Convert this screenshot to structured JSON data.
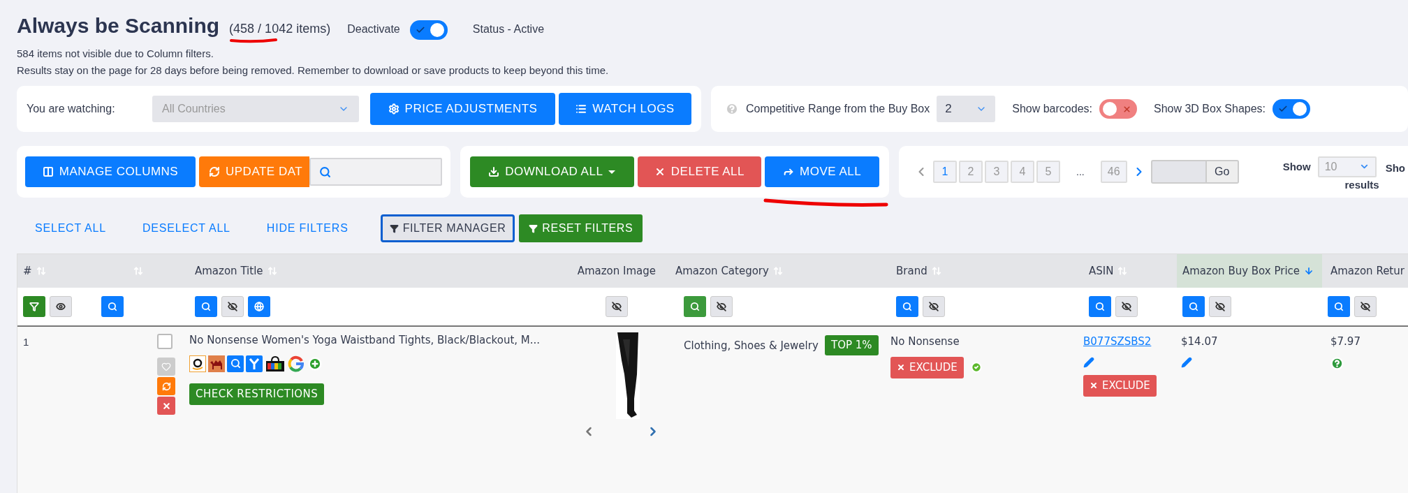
{
  "header": {
    "title": "Always be Scanning",
    "count": "(458 / 1042 items)",
    "toggle_label": "Deactivate",
    "toggle_on": true,
    "status": "Status - Active"
  },
  "notes": [
    "584 items not visible due to Column filters.",
    "Results stay on the page for 28 days before being removed. Remember to download or save products to keep beyond this time."
  ],
  "watch_panel": {
    "label": "You are watching:",
    "select_placeholder": "All Countries",
    "buttons": [
      {
        "label": "PRICE ADJUSTMENTS",
        "kind": "gear"
      },
      {
        "label": "WATCH LOGS",
        "kind": "list"
      }
    ]
  },
  "settings_panel": {
    "range_label": "Competitive Range from the Buy Box",
    "range_value": "2",
    "toggles": [
      {
        "label": "Show barcodes:",
        "on": false
      },
      {
        "label": "Show 3D Box Shapes:",
        "on": true
      }
    ]
  },
  "column_panel": {
    "buttons": [
      {
        "label": "MANAGE COLUMNS",
        "kind": "columns"
      },
      {
        "label": "UPDATE DAT",
        "kind": "refresh"
      }
    ]
  },
  "bulk_panel": {
    "buttons": [
      {
        "label": "DOWNLOAD ALL",
        "kind": "download"
      },
      {
        "label": "DELETE ALL",
        "kind": "delete"
      },
      {
        "label": "MOVE ALL",
        "kind": "move"
      }
    ]
  },
  "pagination": {
    "pages": [
      {
        "label": "1",
        "selected": true
      },
      {
        "label": "2",
        "selected": false
      },
      {
        "label": "3",
        "selected": false
      },
      {
        "label": "4",
        "selected": false
      },
      {
        "label": "5",
        "selected": false
      }
    ],
    "ellipsis": "...",
    "last_page": "46",
    "go": "Go",
    "show_label": "Show",
    "show_value": "10",
    "results": "results",
    "cut_label": "Sho"
  },
  "links": [
    "SELECT ALL",
    "DESELECT ALL",
    "HIDE FILTERS"
  ],
  "filter_buttons": [
    {
      "label": "FILTER MANAGER",
      "kind": "manager"
    },
    {
      "label": "RESET FILTERS",
      "kind": "reset"
    }
  ],
  "table": {
    "columns": [
      {
        "label": "#",
        "sorted": false,
        "filters": [
          {
            "kind": "filter"
          },
          {
            "kind": "eye"
          }
        ]
      },
      {
        "sorted": false,
        "filters": [
          {
            "kind": "search"
          }
        ]
      },
      {
        "label": "Amazon Title",
        "sorted": false,
        "filters": [
          {
            "kind": "search"
          },
          {
            "kind": "hidden"
          },
          {
            "kind": "globe"
          }
        ]
      },
      {
        "label": "Amazon Image",
        "sorted": false,
        "filters": [
          {
            "kind": "hidden"
          }
        ]
      },
      {
        "label": "Amazon Category",
        "sorted": false,
        "filters": [
          {
            "kind": "search_green"
          },
          {
            "kind": "hidden"
          }
        ]
      },
      {
        "label": "Brand",
        "sorted": false,
        "filters": [
          {
            "kind": "search"
          },
          {
            "kind": "hidden"
          }
        ]
      },
      {
        "label": "ASIN",
        "sorted": false,
        "filters": [
          {
            "kind": "search"
          },
          {
            "kind": "hidden"
          }
        ]
      },
      {
        "label": "Amazon Buy Box Price",
        "sorted": true,
        "filters": [
          {
            "kind": "search"
          },
          {
            "kind": "hidden"
          }
        ]
      },
      {
        "label": "Amazon Retur",
        "sorted": false,
        "filters": [
          {
            "kind": "search"
          },
          {
            "kind": "hidden"
          }
        ]
      }
    ],
    "rows": [
      {
        "number": "1",
        "checked": false,
        "title": "No Nonsense Women's Yoga Waistband Tights, Black/Blackout, M...",
        "restrictions": "CHECK RESTRICTIONS",
        "category": "Clothing, Shoes & Jewelry",
        "rank_badge": "TOP 1%",
        "brand": "No Nonsense",
        "brand_exclude": "EXCLUDE",
        "asin": "B077SZSBS2",
        "asin_exclude": "EXCLUDE",
        "buy_box_price": "$14.07",
        "return": "$7.97"
      }
    ]
  }
}
